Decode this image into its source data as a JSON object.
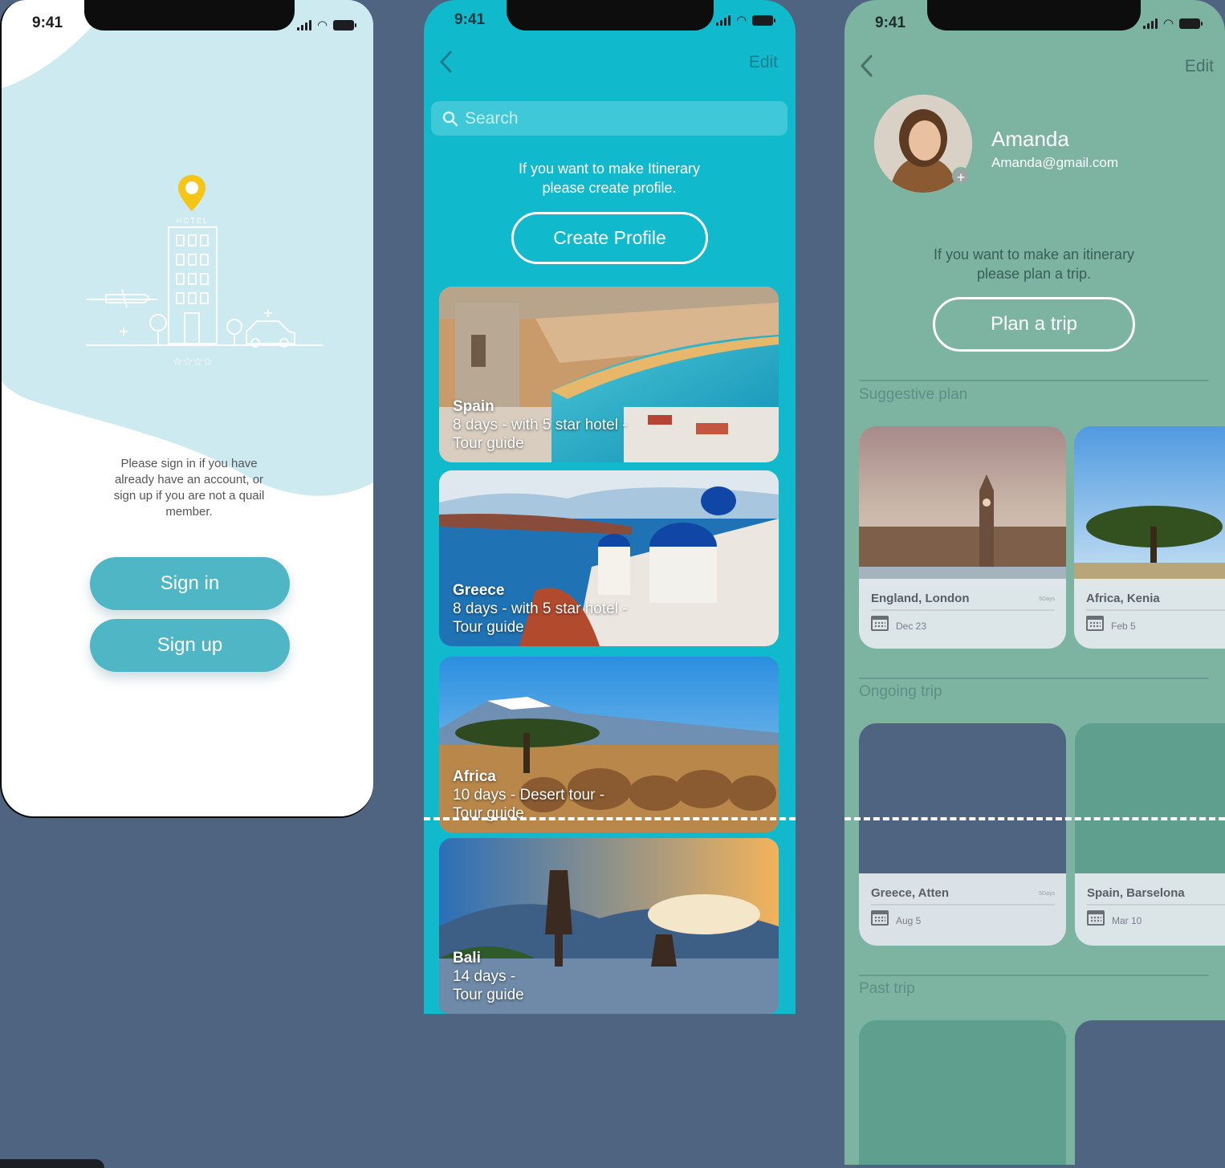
{
  "status_time": "9:41",
  "welcome": {
    "illustration_label": "HOTEL",
    "message": "Please sign in if you have already have an account, or sign up if you are not a quail member.",
    "sign_in_label": "Sign in",
    "sign_up_label": "Sign up"
  },
  "explore": {
    "edit_label": "Edit",
    "search_placeholder": "Search",
    "prompt": "If you want to make Itinerary please create profile.",
    "create_profile_label": "Create Profile",
    "destinations": [
      {
        "country": "Spain",
        "line1": "8 days - with 5 star hotel -",
        "line2": "Tour guide"
      },
      {
        "country": "Greece",
        "line1": "8 days - with 5 star hotel -",
        "line2": "Tour guide"
      },
      {
        "country": "Africa",
        "line1": "10 days - Desert tour -",
        "line2": "Tour guide"
      },
      {
        "country": "Bali",
        "line1": "14 days -",
        "line2": "Tour guide"
      }
    ]
  },
  "profile": {
    "edit_label": "Edit",
    "name": "Amanda",
    "email": "Amanda@gmail.com",
    "prompt": "If you want to make an itinerary please plan a trip.",
    "plan_trip_label": "Plan a trip",
    "suggestive_title": "Suggestive plan",
    "suggestive": [
      {
        "location": "England, London",
        "duration": "5Days",
        "date": "Dec 23"
      },
      {
        "location": "Africa, Kenia",
        "duration": "",
        "date": "Feb 5"
      }
    ],
    "ongoing_title": "Ongoing trip",
    "ongoing": [
      {
        "location": "Greece, Atten",
        "duration": "5Days",
        "date": "Aug 5"
      },
      {
        "location": "Spain, Barselona",
        "duration": "",
        "date": "Mar 10"
      }
    ],
    "past_title": "Past trip"
  },
  "colors": {
    "background": "#4f6480",
    "welcome_button": "#4fb6c5",
    "explore_bg": "#10b9cc",
    "profile_bg": "#7cb3a1",
    "pin": "#f5c518"
  }
}
